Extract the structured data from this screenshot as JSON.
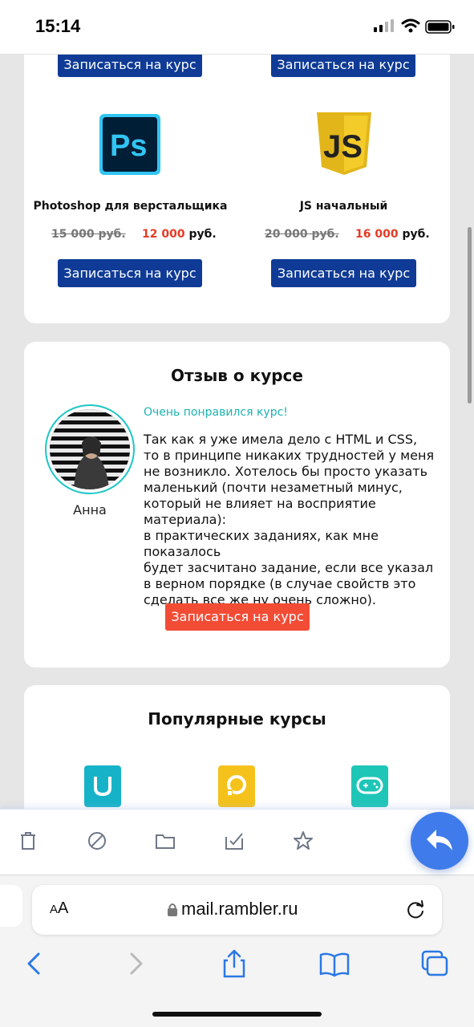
{
  "status_bar": {
    "time": "15:14"
  },
  "courses": {
    "enroll_label": "Записаться на курс",
    "items": [
      {
        "title": "Photoshop для верстальщика",
        "old_price": "15 000 руб.",
        "new_price": "12 000",
        "currency": "руб.",
        "icon": "photoshop-logo"
      },
      {
        "title": "JS начальный",
        "old_price": "20 000 руб.",
        "new_price": "16 000",
        "currency": "руб.",
        "icon": "js-logo"
      }
    ]
  },
  "review": {
    "title": "Отзыв о курсе",
    "author": "Анна",
    "headline": "Очень понравился курс!",
    "lines": [
      "Так как я уже имела дело с HTML и CSS,",
      "то в принципе никаких трудностей у меня",
      "не возникло. Хотелось бы просто указать",
      "маленький (почти незаметный минус,",
      "который не влияет на восприятие материала):",
      "в практических заданиях, как мне показалось",
      "будет засчитано задание, если все указал",
      "в верном порядке (в случае свойств это",
      "сделать все же ну очень сложно)."
    ],
    "button_label": "Записаться на курс"
  },
  "popular": {
    "title": "Популярные курсы",
    "icons": [
      "ux-badge-icon",
      "target-badge-icon",
      "gamepad-badge-icon"
    ],
    "colors": [
      "#16b3c8",
      "#f5c21b",
      "#1ec6b7"
    ]
  },
  "mail_toolbar": {
    "tools": [
      "trash-icon",
      "spam-icon",
      "folder-icon",
      "mark-read-icon",
      "star-icon"
    ],
    "reply": "reply-icon"
  },
  "browser": {
    "text_size": "AA",
    "url": "mail.rambler.ru"
  },
  "colors": {
    "brand_blue": "#0f3b96",
    "accent_red": "#e53b25",
    "accent_teal": "#1cb3b3",
    "fab_blue": "#3f7bea"
  }
}
